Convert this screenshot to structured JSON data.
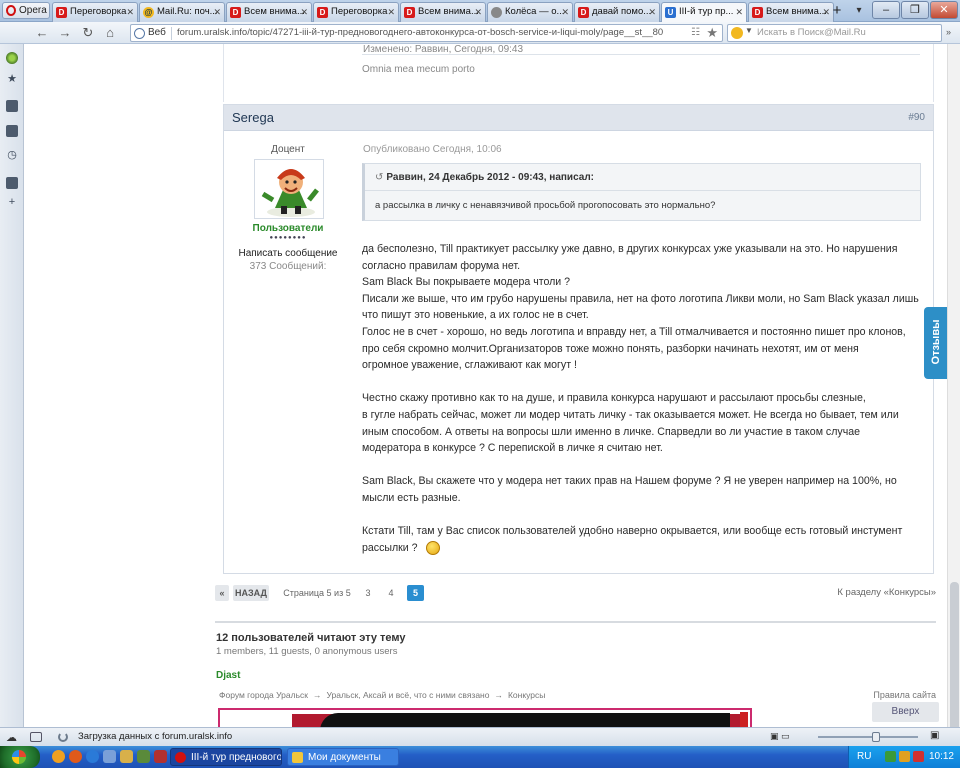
{
  "browser": {
    "opera_button": "Opera",
    "tabs": [
      {
        "title": "Переговорка",
        "icon": "forum-icon"
      },
      {
        "title": "Mail.Ru: поч...",
        "icon": "mail-icon"
      },
      {
        "title": "Всем внима...",
        "icon": "forum-icon"
      },
      {
        "title": "Переговорка",
        "icon": "forum-icon"
      },
      {
        "title": "Всем внима...",
        "icon": "forum-icon"
      },
      {
        "title": "Колёса — о...",
        "icon": "globe-icon"
      },
      {
        "title": "давай помо...",
        "icon": "forum-icon"
      },
      {
        "title": "III-й тур пр...",
        "icon": "u-icon",
        "active": true
      },
      {
        "title": "Всем внима...",
        "icon": "forum-icon"
      }
    ],
    "web_label": "Веб",
    "url": "forum.uralsk.info/topic/47271-iii-й-тур-предновогоднего-автоконкурса-от-bosch-service-и-liqui-moly/page__st__80",
    "search_placeholder": "Искать в Поиск@Mail.Ru"
  },
  "previous_post": {
    "edited_text": "Изменено: Раввин, Сегодня, 09:43",
    "signature": "Omnia mea mecum porto"
  },
  "post": {
    "author": "Serega",
    "number": "#90",
    "rank": "Доцент",
    "group": "Пользователи",
    "pips": "●●●●●●●●",
    "send_message": "Написать сообщение",
    "post_count": "373 Сообщений:",
    "published": "Опубликовано Сегодня, 10:06",
    "quote_author": "Раввин, 24 Декабрь 2012 - 09:43, написал:",
    "quote_text": "а рассылка в личку с  ненавязчивой просьбой прогопосовать это нормально?",
    "message_lines": [
      "да бесполезно, Till практикует рассылку уже давно, в других конкурсах уже указывали на это. Но нарушения",
      "согласно правилам форума нет.",
      "Sam Black Вы покрываете модера чтоли ?",
      "Писали же выше, что им грубо нарушены правила, нет на фото логотипа Ликви моли, но Sam Black указал лишь",
      "что пишут это новенькие, а их голос не в счет.",
      "Голос не в счет  - хорошо, но ведь логотипа и вправду нет, а Till отмалчивается и постоянно пишет про клонов,",
      "про себя скромно молчит.Организаторов тоже можно понять, разборки начинать нехотят, им от меня",
      "огромное уважение, сглаживают как могут !",
      "",
      "Честно скажу противно как то на душе, и правила конкурса нарушают и рассылают просьбы слезные,",
      "в гугле набрать сейчас, может ли модер читать личку - так оказывается может. Не всегда но бывает, тем или",
      "иным способом. А ответы на вопросы шли именно в личке. Спарведли во ли участие в таком случае",
      "модератора в конкурсе ? С перепиской в личке я считаю нет.",
      "",
      "Sam Black, Вы скажете что у модера нет таких прав на Нашем форуме ? Я не уверен например на 100%, но",
      "мысли есть разные.",
      "",
      "Кстати Till, там у Вас список пользователей удобно наверно окрывается, или вообще есть готовый инстумент",
      "рассылки ?"
    ]
  },
  "feedback_tab": "Отзывы",
  "pagination": {
    "first": "«",
    "back": "НАЗАД",
    "page_info": "Страница 5 из 5",
    "pages": [
      "3",
      "4",
      "5"
    ],
    "current": "5",
    "to_section": "К разделу «Конкурсы»"
  },
  "readers": {
    "title": "12 пользователей читают эту тему",
    "subtitle": "1 members, 11 guests, 0 anonymous users",
    "users": [
      "Djast"
    ]
  },
  "breadcrumbs": [
    "Форум города Уральск",
    "Уральск, Аксай и всё, что с ними связано",
    "Конкурсы"
  ],
  "breadcrumb_arrow": "→",
  "rules_link": "Правила сайта",
  "to_top": "Вверх",
  "statusbar": {
    "loading_text": "Загрузка данных с forum.uralsk.info"
  },
  "taskbar": {
    "tasks": [
      {
        "title": "III-й тур предновогo...",
        "active": true
      },
      {
        "title": "Мои документы",
        "active": false
      }
    ],
    "lang": "RU",
    "clock": "10:12"
  },
  "colors": {
    "accent_blue": "#2a8ed0",
    "group_green": "#2a8a2a",
    "post_header": "#dfe4ec",
    "feedback_blue": "#2d8fc7"
  }
}
